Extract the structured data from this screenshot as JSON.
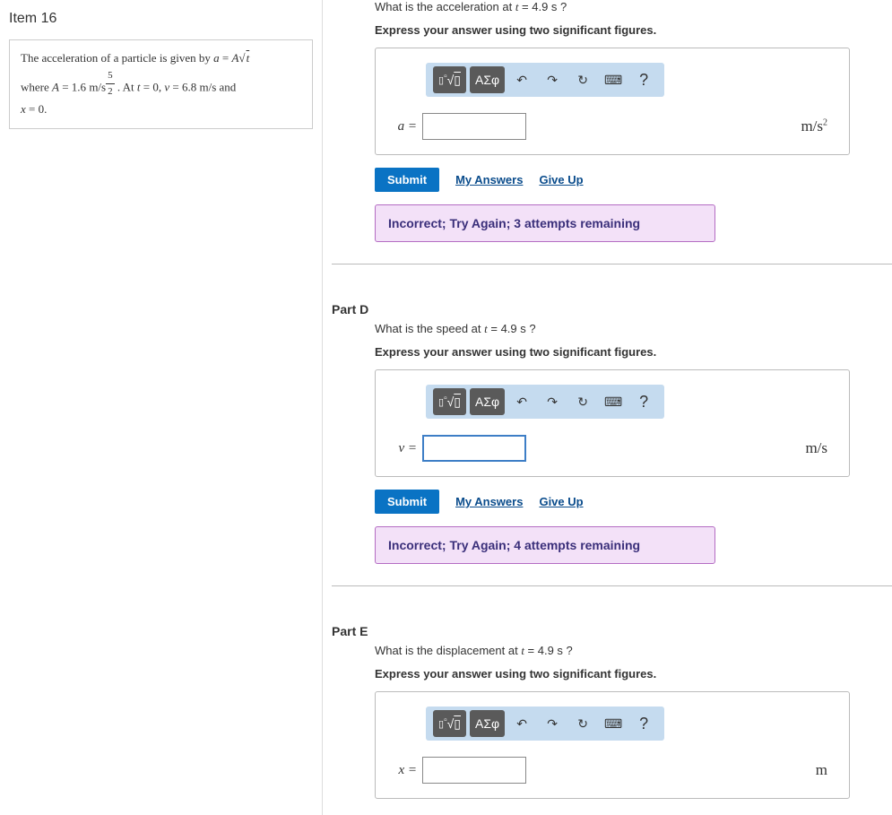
{
  "left": {
    "item_title": "Item 16",
    "prompt_html_1": "The acceleration of a particle is given by ",
    "eq1": "a = A√t",
    "prompt_html_2": "where ",
    "A_label": "A",
    "A_value": " = 1.6 ",
    "A_units_pre": "m/s",
    "A_exp_top": "5",
    "A_exp_bot": "2",
    "prompt_html_3": " . At ",
    "t0": "t = 0",
    "prompt_html_4": ", ",
    "v0": "v = 6.8 m/s",
    "prompt_html_5": " and ",
    "x0": "x = 0",
    "prompt_html_6": "."
  },
  "toolbar": {
    "templates_icon": "▮√☐",
    "greek_label": "ΑΣφ",
    "undo": "↶",
    "redo": "↷",
    "reset": "↻",
    "keyboard": "⌨",
    "help": "?"
  },
  "actions": {
    "submit": "Submit",
    "my_answers": "My Answers",
    "give_up": "Give Up"
  },
  "parts": {
    "c": {
      "question_pre": "What is the acceleration at ",
      "question_t": "t",
      "question_val": " = 4.9 s ?",
      "instruction": "Express your answer using two significant figures.",
      "var": "a =",
      "units": "m/s²",
      "feedback": "Incorrect; Try Again; 3 attempts remaining"
    },
    "d": {
      "label": "Part D",
      "question_pre": "What is the speed at ",
      "question_t": "t",
      "question_val": " = 4.9 s ?",
      "instruction": "Express your answer using two significant figures.",
      "var": "v =",
      "units": "m/s",
      "feedback": "Incorrect; Try Again; 4 attempts remaining"
    },
    "e": {
      "label": "Part E",
      "question_pre": "What is the displacement at ",
      "question_t": "t",
      "question_val": " = 4.9 s ?",
      "instruction": "Express your answer using two significant figures.",
      "var": "x =",
      "units": "m"
    }
  }
}
